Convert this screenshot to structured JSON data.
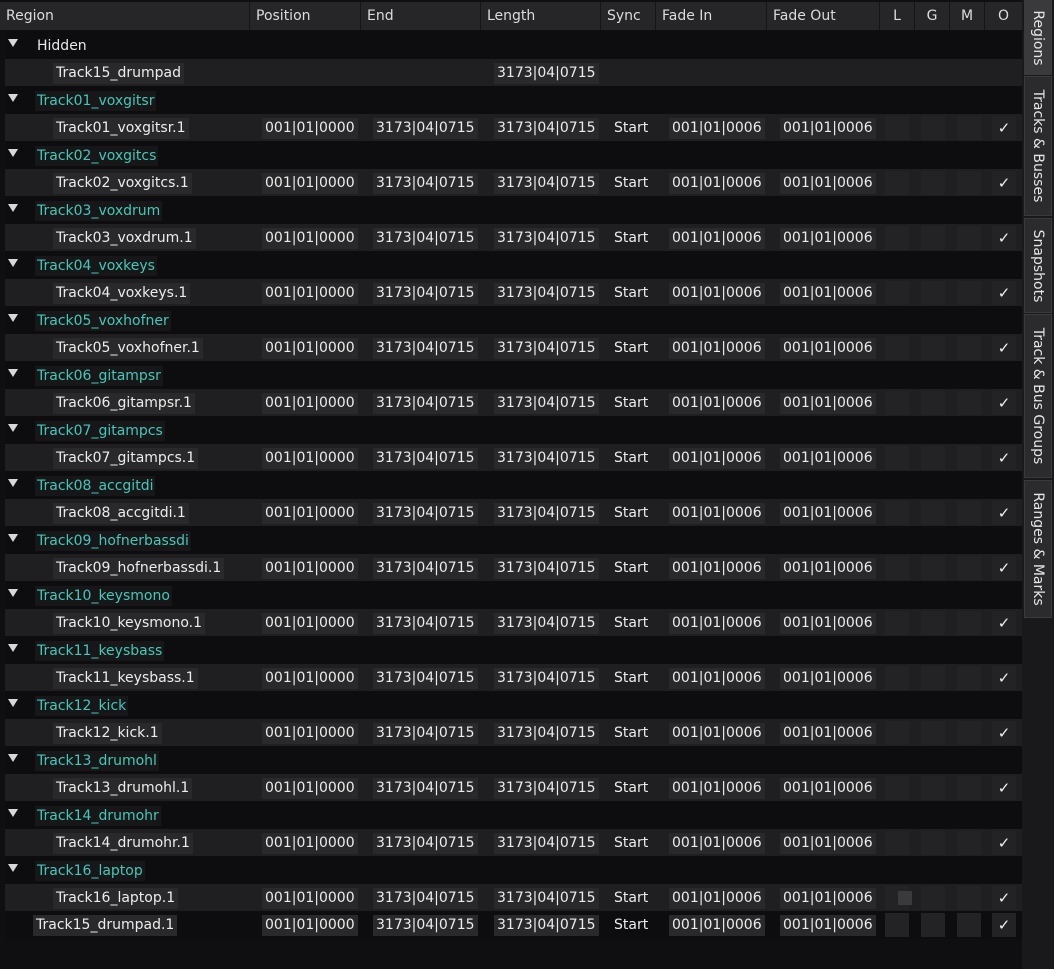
{
  "columns": {
    "region": "Region",
    "position": "Position",
    "end": "End",
    "length": "Length",
    "sync": "Sync",
    "fade_in": "Fade In",
    "fade_out": "Fade Out",
    "l": "L",
    "g": "G",
    "m": "M",
    "o": "O"
  },
  "hidden_group": {
    "name": "Hidden",
    "region": "Track15_drumpad",
    "length": "3173|04|0715"
  },
  "tracks": [
    {
      "group": "Track01_voxgitsr",
      "region": "Track01_voxgitsr.1",
      "position": "001|01|0000",
      "end": "3173|04|0715",
      "length": "3173|04|0715",
      "sync": "Start",
      "fade_in": "001|01|0006",
      "fade_out": "001|01|0006",
      "o": "✓"
    },
    {
      "group": "Track02_voxgitcs",
      "region": "Track02_voxgitcs.1",
      "position": "001|01|0000",
      "end": "3173|04|0715",
      "length": "3173|04|0715",
      "sync": "Start",
      "fade_in": "001|01|0006",
      "fade_out": "001|01|0006",
      "o": "✓"
    },
    {
      "group": "Track03_voxdrum",
      "region": "Track03_voxdrum.1",
      "position": "001|01|0000",
      "end": "3173|04|0715",
      "length": "3173|04|0715",
      "sync": "Start",
      "fade_in": "001|01|0006",
      "fade_out": "001|01|0006",
      "o": "✓"
    },
    {
      "group": "Track04_voxkeys",
      "region": "Track04_voxkeys.1",
      "position": "001|01|0000",
      "end": "3173|04|0715",
      "length": "3173|04|0715",
      "sync": "Start",
      "fade_in": "001|01|0006",
      "fade_out": "001|01|0006",
      "o": "✓"
    },
    {
      "group": "Track05_voxhofner",
      "region": "Track05_voxhofner.1",
      "position": "001|01|0000",
      "end": "3173|04|0715",
      "length": "3173|04|0715",
      "sync": "Start",
      "fade_in": "001|01|0006",
      "fade_out": "001|01|0006",
      "o": "✓"
    },
    {
      "group": "Track06_gitampsr",
      "region": "Track06_gitampsr.1",
      "position": "001|01|0000",
      "end": "3173|04|0715",
      "length": "3173|04|0715",
      "sync": "Start",
      "fade_in": "001|01|0006",
      "fade_out": "001|01|0006",
      "o": "✓"
    },
    {
      "group": "Track07_gitampcs",
      "region": "Track07_gitampcs.1",
      "position": "001|01|0000",
      "end": "3173|04|0715",
      "length": "3173|04|0715",
      "sync": "Start",
      "fade_in": "001|01|0006",
      "fade_out": "001|01|0006",
      "o": "✓"
    },
    {
      "group": "Track08_accgitdi",
      "region": "Track08_accgitdi.1",
      "position": "001|01|0000",
      "end": "3173|04|0715",
      "length": "3173|04|0715",
      "sync": "Start",
      "fade_in": "001|01|0006",
      "fade_out": "001|01|0006",
      "o": "✓"
    },
    {
      "group": "Track09_hofnerbassdi",
      "region": "Track09_hofnerbassdi.1",
      "position": "001|01|0000",
      "end": "3173|04|0715",
      "length": "3173|04|0715",
      "sync": "Start",
      "fade_in": "001|01|0006",
      "fade_out": "001|01|0006",
      "o": "✓"
    },
    {
      "group": "Track10_keysmono",
      "region": "Track10_keysmono.1",
      "position": "001|01|0000",
      "end": "3173|04|0715",
      "length": "3173|04|0715",
      "sync": "Start",
      "fade_in": "001|01|0006",
      "fade_out": "001|01|0006",
      "o": "✓"
    },
    {
      "group": "Track11_keysbass",
      "region": "Track11_keysbass.1",
      "position": "001|01|0000",
      "end": "3173|04|0715",
      "length": "3173|04|0715",
      "sync": "Start",
      "fade_in": "001|01|0006",
      "fade_out": "001|01|0006",
      "o": "✓"
    },
    {
      "group": "Track12_kick",
      "region": "Track12_kick.1",
      "position": "001|01|0000",
      "end": "3173|04|0715",
      "length": "3173|04|0715",
      "sync": "Start",
      "fade_in": "001|01|0006",
      "fade_out": "001|01|0006",
      "o": "✓"
    },
    {
      "group": "Track13_drumohl",
      "region": "Track13_drumohl.1",
      "position": "001|01|0000",
      "end": "3173|04|0715",
      "length": "3173|04|0715",
      "sync": "Start",
      "fade_in": "001|01|0006",
      "fade_out": "001|01|0006",
      "o": "✓"
    },
    {
      "group": "Track14_drumohr",
      "region": "Track14_drumohr.1",
      "position": "001|01|0000",
      "end": "3173|04|0715",
      "length": "3173|04|0715",
      "sync": "Start",
      "fade_in": "001|01|0006",
      "fade_out": "001|01|0006",
      "o": "✓"
    },
    {
      "group": "Track16_laptop",
      "region": "Track16_laptop.1",
      "position": "001|01|0000",
      "end": "3173|04|0715",
      "length": "3173|04|0715",
      "sync": "Start",
      "fade_in": "001|01|0006",
      "fade_out": "001|01|0006",
      "o": "✓"
    }
  ],
  "loose_region": {
    "region": "Track15_drumpad.1",
    "position": "001|01|0000",
    "end": "3173|04|0715",
    "length": "3173|04|0715",
    "sync": "Start",
    "fade_in": "001|01|0006",
    "fade_out": "001|01|0006",
    "o": "✓"
  },
  "sidebar_tabs": [
    "Regions",
    "Tracks & Busses",
    "Snapshots",
    "Track & Bus Groups",
    "Ranges & Marks"
  ],
  "colors": {
    "group_name": "#3fc9b8",
    "background": "#0f0f11",
    "row_alt": "#1f1f21"
  }
}
